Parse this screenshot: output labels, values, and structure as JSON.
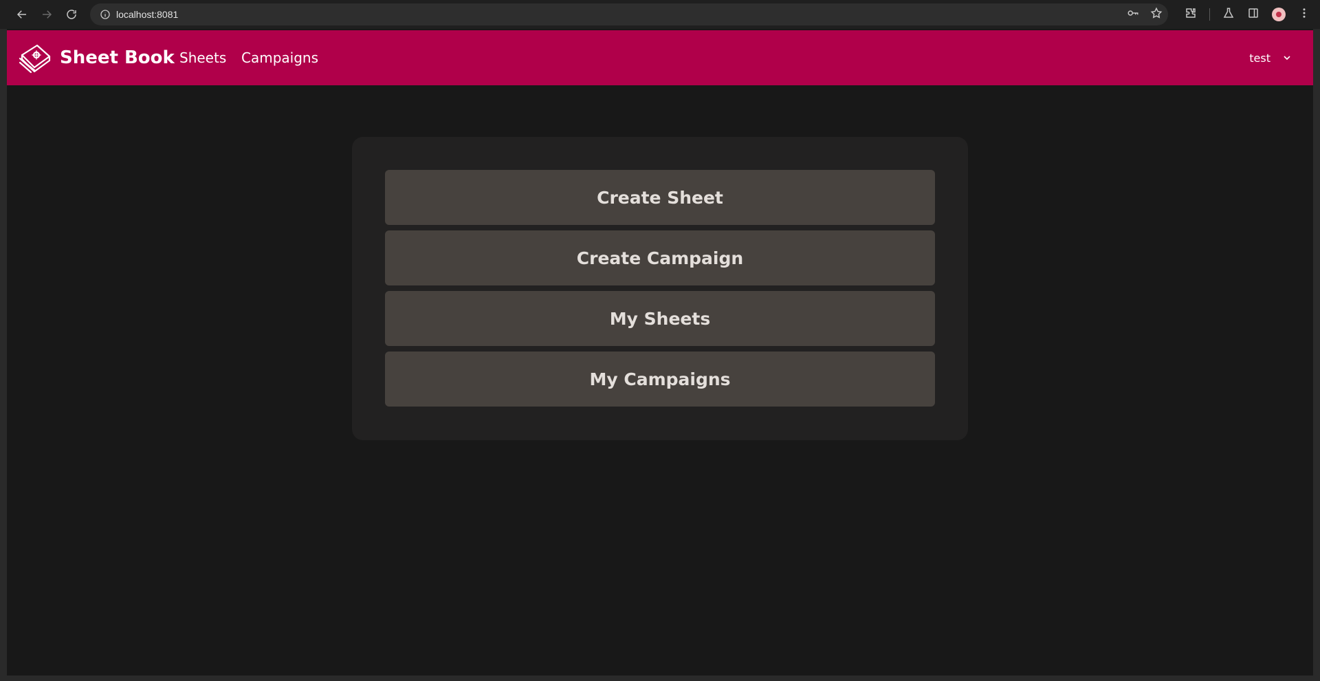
{
  "browser": {
    "url": "localhost:8081"
  },
  "header": {
    "brand": "Sheet Book",
    "nav": [
      {
        "label": "Sheets"
      },
      {
        "label": "Campaigns"
      }
    ],
    "user": "test",
    "color": "#b0004a"
  },
  "menu": {
    "buttons": [
      {
        "label": "Create Sheet"
      },
      {
        "label": "Create Campaign"
      },
      {
        "label": "My Sheets"
      },
      {
        "label": "My Campaigns"
      }
    ]
  }
}
